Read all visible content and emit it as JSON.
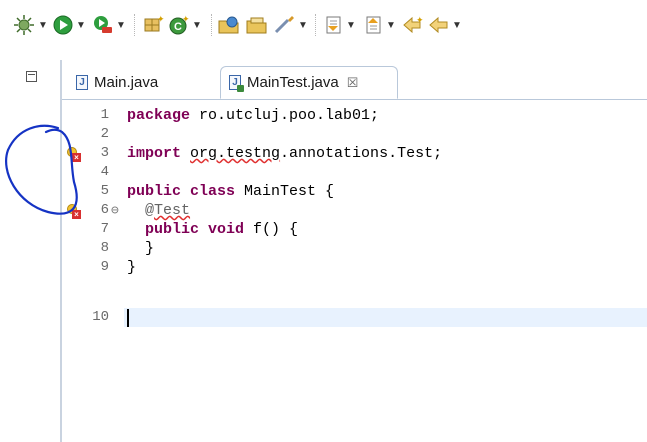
{
  "toolbar": {
    "items": [
      {
        "name": "debug-icon"
      },
      {
        "name": "run-icon"
      },
      {
        "name": "external-tools-icon"
      },
      {
        "name": "new-package-icon"
      },
      {
        "name": "new-class-icon"
      },
      {
        "name": "open-type-icon"
      },
      {
        "name": "open-task-icon"
      },
      {
        "name": "search-icon"
      },
      {
        "name": "next-annotation-icon"
      },
      {
        "name": "previous-annotation-icon"
      },
      {
        "name": "last-edit-icon"
      },
      {
        "name": "back-icon"
      }
    ]
  },
  "tabs": [
    {
      "label": "Main.java",
      "icon": "J",
      "active": false
    },
    {
      "label": "MainTest.java",
      "icon": "J",
      "active": true,
      "close": "☒"
    }
  ],
  "editor": {
    "lines": [
      {
        "num": "1",
        "text": "package ro.utcluj.poo.lab01;"
      },
      {
        "num": "2",
        "text": ""
      },
      {
        "num": "3",
        "text": "import org.testng.annotations.Test;"
      },
      {
        "num": "4",
        "text": ""
      },
      {
        "num": "5",
        "text": "public class MainTest {"
      },
      {
        "num": "6",
        "text": "  @Test"
      },
      {
        "num": "7",
        "text": "  public void f() {"
      },
      {
        "num": "8",
        "text": "  }"
      },
      {
        "num": "9",
        "text": "}"
      },
      {
        "num": "10",
        "text": ""
      }
    ],
    "tokens": {
      "l1_kw": "package",
      "l1_rest": " ro.utcluj.poo.lab01;",
      "l3_kw": "import",
      "l3_sp": " ",
      "l3_err": "org.testng",
      "l3_rest": ".annotations.Test;",
      "l5_kw": "public class",
      "l5_rest": " MainTest {",
      "l6_pre": "  ",
      "l6_at": "@",
      "l6_err": "Test",
      "l7_pre": "  ",
      "l7_kw": "public void",
      "l7_rest": " f() {",
      "l8": "  }",
      "l9": "}"
    },
    "fold_marker": "⊖",
    "error_marker_lines": [
      "3",
      "6"
    ]
  }
}
